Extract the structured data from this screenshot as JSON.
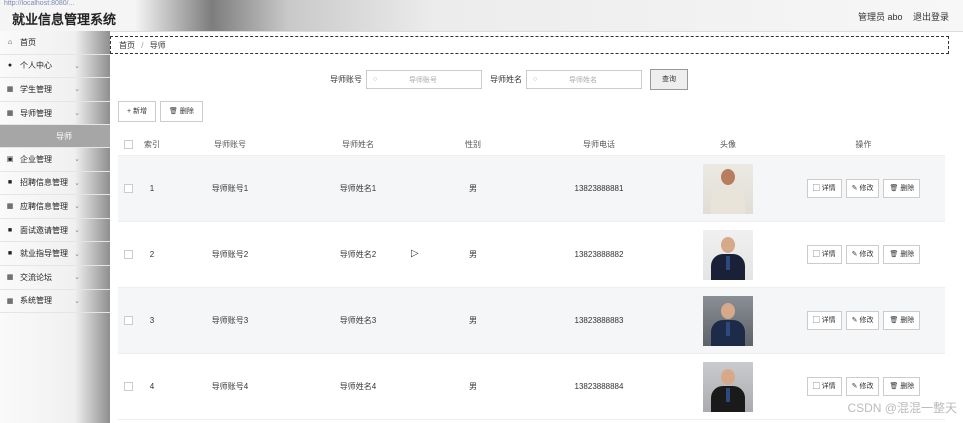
{
  "app": {
    "tiny_caption": "http://localhost:8080/...",
    "title": "就业信息管理系统",
    "user_label": "管理员 abo",
    "logout_label": "退出登录"
  },
  "sidebar": {
    "items": [
      {
        "icon": "home-icon",
        "label": "首页",
        "has_chevron": false
      },
      {
        "icon": "person-icon",
        "label": "个人中心",
        "has_chevron": true
      },
      {
        "icon": "grid-icon",
        "label": "学生管理",
        "has_chevron": true
      },
      {
        "icon": "grid-icon",
        "label": "导师管理",
        "has_chevron": true
      },
      {
        "icon": "",
        "label": "导师",
        "has_chevron": false,
        "is_sub": true
      },
      {
        "icon": "building-icon",
        "label": "企业管理",
        "has_chevron": true
      },
      {
        "icon": "doc-icon",
        "label": "招聘信息管理",
        "has_chevron": true
      },
      {
        "icon": "grid-icon",
        "label": "应聘信息管理",
        "has_chevron": true
      },
      {
        "icon": "doc-icon",
        "label": "面试邀请管理",
        "has_chevron": true
      },
      {
        "icon": "doc-icon",
        "label": "就业指导管理",
        "has_chevron": true
      },
      {
        "icon": "grid-icon",
        "label": "交流论坛",
        "has_chevron": true
      },
      {
        "icon": "grid-icon",
        "label": "系统管理",
        "has_chevron": true
      }
    ]
  },
  "breadcrumb": {
    "home": "首页",
    "separator": "/",
    "current": "导师"
  },
  "search": {
    "field1_label": "导师账号",
    "field1_placeholder": "导师账号",
    "field2_label": "导师姓名",
    "field2_placeholder": "导师姓名",
    "button_label": "查询"
  },
  "actions": {
    "add_label": "+ 新增",
    "delete_label": "删除"
  },
  "table": {
    "columns": [
      "索引",
      "导师账号",
      "导师姓名",
      "性别",
      "导师电话",
      "头像",
      "操作"
    ],
    "rows": [
      {
        "index": "1",
        "account": "导师账号1",
        "name": "导师姓名1",
        "gender": "男",
        "phone": "13823888881"
      },
      {
        "index": "2",
        "account": "导师账号2",
        "name": "导师姓名2",
        "gender": "男",
        "phone": "13823888882"
      },
      {
        "index": "3",
        "account": "导师账号3",
        "name": "导师姓名3",
        "gender": "男",
        "phone": "13823888883"
      },
      {
        "index": "4",
        "account": "导师账号4",
        "name": "导师姓名4",
        "gender": "男",
        "phone": "13823888884"
      }
    ],
    "op_labels": {
      "detail": "详情",
      "edit": "修改",
      "delete": "删除"
    }
  },
  "watermark": "CSDN @混混一整天"
}
